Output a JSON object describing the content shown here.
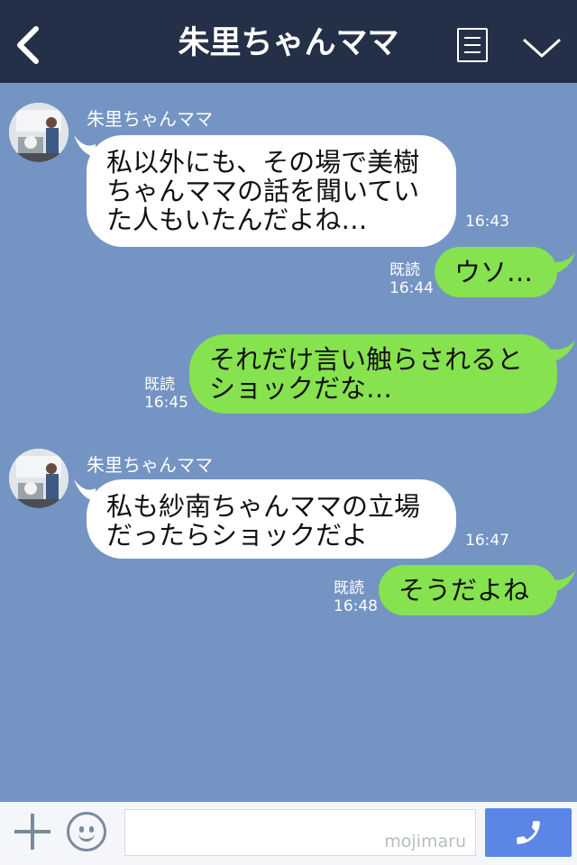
{
  "header": {
    "title": "朱里ちゃんママ"
  },
  "messages": [
    {
      "side": "in",
      "sender": "朱里ちゃんママ",
      "lines": [
        "私以外にも、その場で美樹",
        "ちゃんママの話を聞いてい",
        "た人もいたんだよね…"
      ],
      "time": "16:43"
    },
    {
      "side": "out",
      "read": "既読",
      "lines": [
        "ウソ…"
      ],
      "time": "16:44"
    },
    {
      "side": "out",
      "read": "既読",
      "lines": [
        "それだけ言い触らされると",
        "ショックだな…"
      ],
      "time": "16:45"
    },
    {
      "side": "in",
      "sender": "朱里ちゃんママ",
      "lines": [
        "私も紗南ちゃんママの立場",
        "だったらショックだよ"
      ],
      "time": "16:47"
    },
    {
      "side": "out",
      "read": "既読",
      "lines": [
        "そうだよね"
      ],
      "time": "16:48"
    }
  ],
  "input": {
    "watermark": "mojimaru"
  },
  "colors": {
    "header": "#243047",
    "background": "#7494c3",
    "outgoing_bubble": "#86e24e",
    "incoming_bubble": "#ffffff",
    "send_button": "#5b86e6"
  },
  "icons": [
    "back-arrow-icon",
    "menu-icon",
    "chevron-down-icon",
    "plus-icon",
    "emoji-icon",
    "phone-icon"
  ]
}
